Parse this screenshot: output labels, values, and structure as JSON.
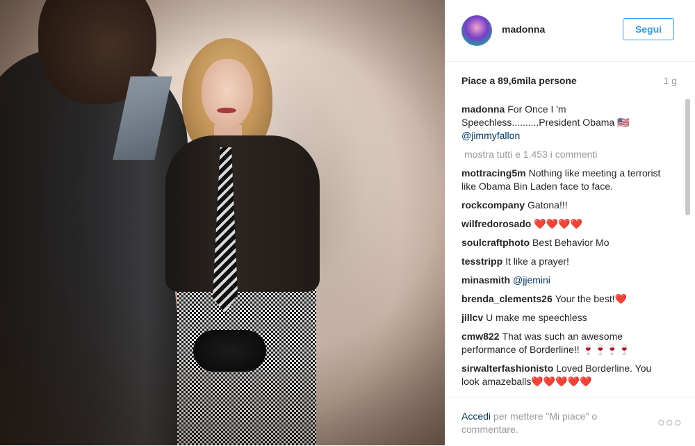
{
  "post": {
    "username": "madonna",
    "follow_label": "Segui",
    "likes": "Piace a 89,6mila persone",
    "time": "1 g",
    "caption": {
      "user": "madonna",
      "text": "For Once I 'm Speechless..........President Obama 🇺🇸",
      "mention": "@jimmyfallon"
    },
    "view_all": "mostra tutti e 1.453 i commenti",
    "comments": [
      {
        "user": "mottracing5m",
        "text": "Nothing like meeting a terrorist like Obama Bin Laden face to face.",
        "mention": "",
        "hearts": ""
      },
      {
        "user": "rockcompany",
        "text": "Gatona!!!",
        "mention": "",
        "hearts": ""
      },
      {
        "user": "wilfredorosado",
        "text": "",
        "mention": "",
        "hearts": "❤️❤️❤️❤️"
      },
      {
        "user": "soulcraftphoto",
        "text": "Best Behavior Mo",
        "mention": "",
        "hearts": ""
      },
      {
        "user": "tesstripp",
        "text": "It like a prayer!",
        "mention": "",
        "hearts": ""
      },
      {
        "user": "minasmith",
        "text": "",
        "mention": "@jjemini",
        "hearts": ""
      },
      {
        "user": "brenda_clements26",
        "text": "Your the best!",
        "mention": "",
        "hearts": "❤️"
      },
      {
        "user": "jillcv",
        "text": "U make me speechless",
        "mention": "",
        "hearts": ""
      },
      {
        "user": "cmw822",
        "text": "That was such an awesome performance of Borderline!! 🍷🍷🍷🍷",
        "mention": "",
        "hearts": ""
      },
      {
        "user": "sirwalterfashionisto",
        "text": "Loved Borderline. You look amazeballs",
        "mention": "",
        "hearts": "❤️❤️❤️❤️❤️"
      }
    ],
    "footer": {
      "login_link": "Accedi",
      "login_text": "per mettere \"Mi piace\" o commentare.",
      "more_icon": "ellipsis-icon",
      "more_glyph": "○○○"
    }
  },
  "colors": {
    "accent": "#3897f0",
    "link": "#003569",
    "muted": "#999999",
    "heart": "#ed4956"
  }
}
